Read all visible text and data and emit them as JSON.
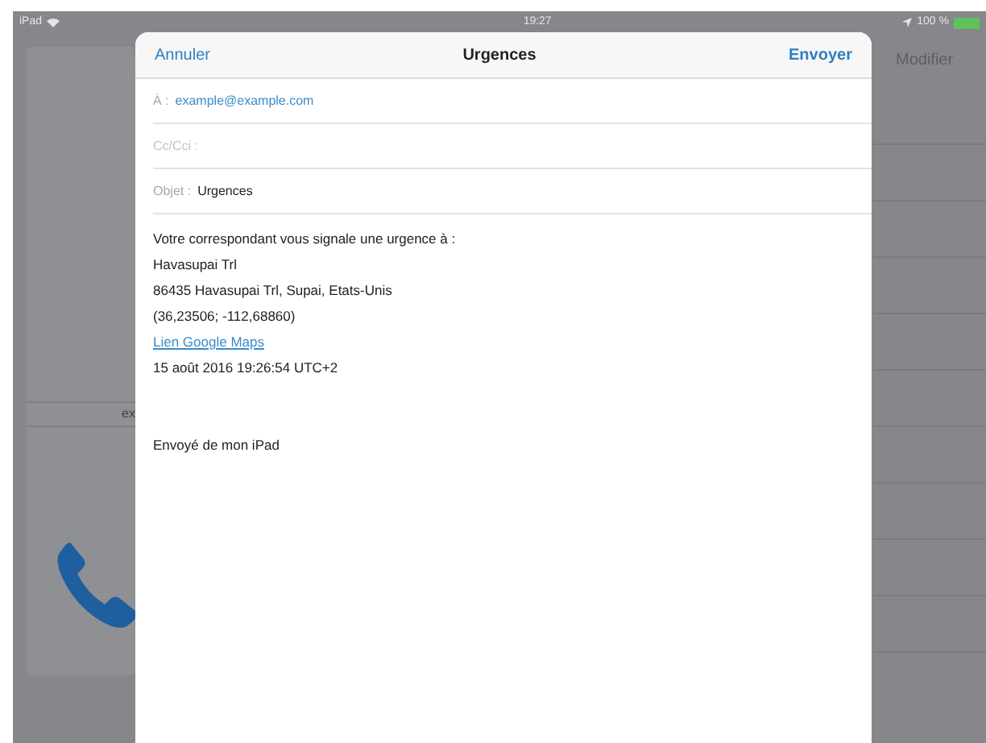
{
  "status_bar": {
    "device": "iPad",
    "time": "19:27",
    "battery": "100 %"
  },
  "background": {
    "edit_button": "Modifier",
    "fragment": "ex"
  },
  "compose": {
    "cancel": "Annuler",
    "title": "Urgences",
    "send": "Envoyer",
    "fields": [
      {
        "label": "À :",
        "value": "example@example.com",
        "kind": "recipient"
      },
      {
        "label": "Cc/Cci :",
        "kind": "empty"
      },
      {
        "label": "Objet :",
        "value": "Urgences",
        "kind": "subject"
      }
    ],
    "body": [
      {
        "kind": "text",
        "text": "Votre correspondant vous signale une urgence à :"
      },
      {
        "kind": "text",
        "text": "Havasupai Trl"
      },
      {
        "kind": "text",
        "text": "86435 Havasupai Trl, Supai, Etats-Unis"
      },
      {
        "kind": "text",
        "text": "(36,23506; -112,68860)"
      },
      {
        "kind": "link",
        "text": "Lien Google Maps"
      },
      {
        "kind": "text",
        "text": "15 août 2016 19:26:54 UTC+2"
      },
      {
        "kind": "blank"
      },
      {
        "kind": "blank"
      },
      {
        "kind": "text",
        "text": "Envoyé de mon iPad"
      }
    ]
  }
}
